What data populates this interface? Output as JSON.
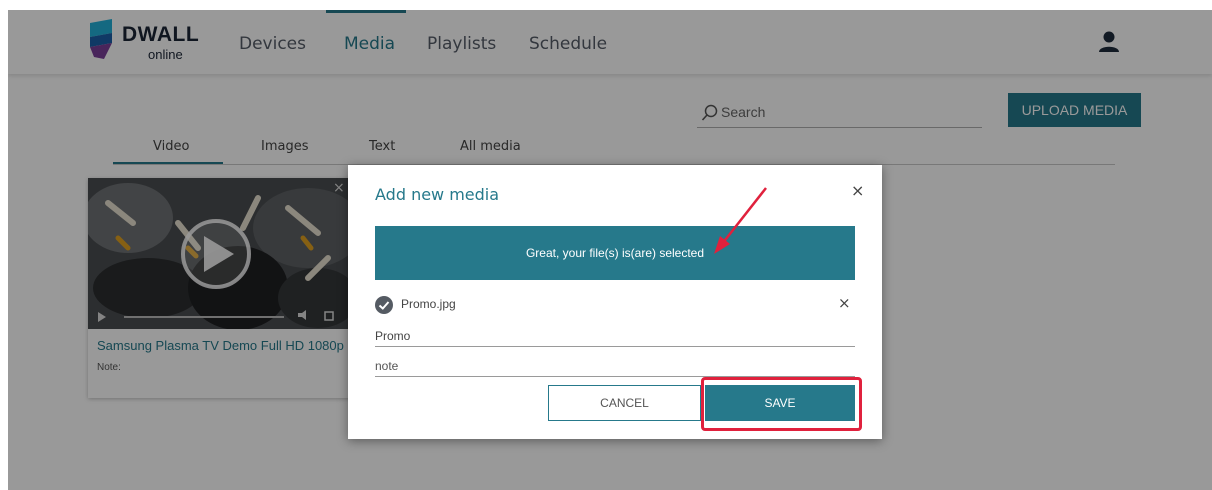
{
  "logo": {
    "brand": "DWALL",
    "sub": "online"
  },
  "nav": {
    "items": [
      {
        "label": "Devices",
        "active": false
      },
      {
        "label": "Media",
        "active": true
      },
      {
        "label": "Playlists",
        "active": false
      },
      {
        "label": "Schedule",
        "active": false
      }
    ],
    "user_icon": "user-icon"
  },
  "toolbar": {
    "search_placeholder": "Search",
    "upload_label": "UPLOAD MEDIA"
  },
  "tabs": {
    "items": [
      "Video",
      "Images",
      "Text",
      "All media"
    ],
    "active": "Video"
  },
  "media_card": {
    "title": "Samsung Plasma TV Demo Full HD 1080p",
    "note": "Note:",
    "close": "×"
  },
  "modal": {
    "title": "Add new media",
    "close": "×",
    "drop_message": "Great, your file(s) is(are) selected",
    "file": {
      "name": "Promo.jpg",
      "remove": "×",
      "status_icon": "check-circle-icon"
    },
    "name_field_value": "Promo",
    "note_field_placeholder": "note",
    "cancel_label": "CANCEL",
    "save_label": "SAVE"
  },
  "colors": {
    "accent": "#26798b",
    "annotation": "#e0213d",
    "overlay": "rgba(0,0,0,0.4)"
  }
}
